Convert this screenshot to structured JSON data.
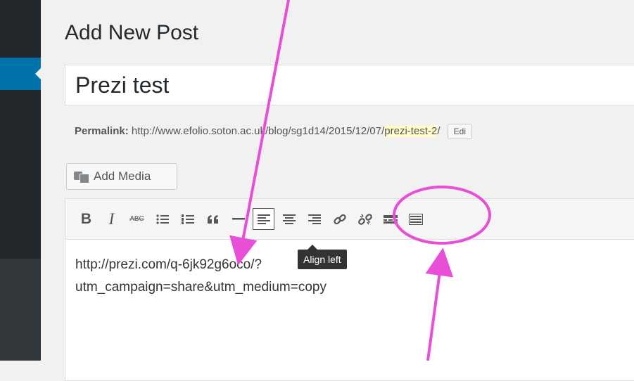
{
  "page": {
    "heading": "Add New Post"
  },
  "title": {
    "value": "Prezi test"
  },
  "permalink": {
    "label": "Permalink:",
    "base_url": "http://www.efolio.soton.ac.uk/blog/sg1d14/2015/12/07/",
    "slug": "prezi-test-2",
    "trailing_slash": "/",
    "edit_label": "Edi"
  },
  "media": {
    "add_label": "Add Media"
  },
  "toolbar": {
    "buttons": [
      {
        "name": "bold",
        "label": "B"
      },
      {
        "name": "italic",
        "label": "I"
      },
      {
        "name": "strikethrough",
        "label": "ABC"
      },
      {
        "name": "bulleted-list",
        "label": ""
      },
      {
        "name": "numbered-list",
        "label": ""
      },
      {
        "name": "blockquote",
        "label": "“"
      },
      {
        "name": "horizontal-line",
        "label": "—"
      },
      {
        "name": "align-left",
        "label": "",
        "active": true
      },
      {
        "name": "align-center",
        "label": ""
      },
      {
        "name": "align-right",
        "label": ""
      },
      {
        "name": "insert-link",
        "label": ""
      },
      {
        "name": "remove-link",
        "label": ""
      },
      {
        "name": "read-more",
        "label": ""
      },
      {
        "name": "toolbar-toggle",
        "label": ""
      }
    ],
    "tooltip": "Align left"
  },
  "editor": {
    "line1": "http://prezi.com/q-6jk92g6oco/?",
    "line2": "utm_campaign=share&utm_medium=copy"
  },
  "colors": {
    "annotation": "#e84fd6",
    "admin_bar": "#23282d",
    "active_menu": "#0073aa"
  }
}
